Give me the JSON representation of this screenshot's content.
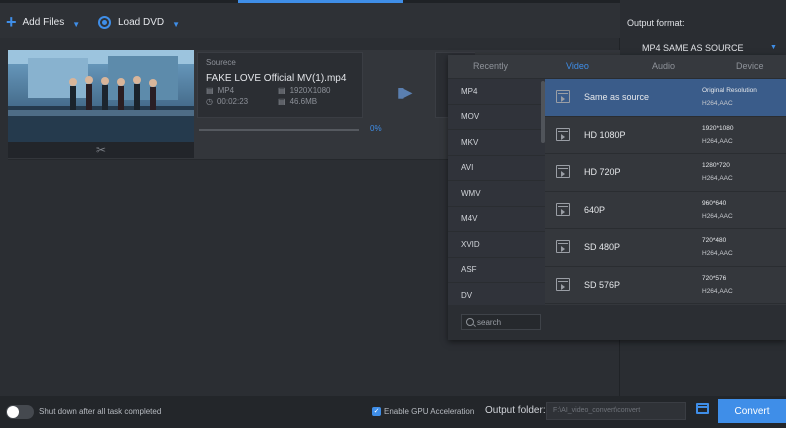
{
  "toolbar": {
    "add_files": "Add Files",
    "load_dvd": "Load DVD"
  },
  "task": {
    "source_label": "Sourece",
    "file_name": "FAKE LOVE Official MV(1).mp4",
    "format": "MP4",
    "resolution": "1920X1080",
    "duration": "00:02:23",
    "size": "46.6MB",
    "progress_text": "0%",
    "progress": 0
  },
  "output": {
    "label": "Output format:",
    "value": "MP4 SAME AS SOURCE"
  },
  "tabs": [
    "Recently",
    "Video",
    "Audio",
    "Device"
  ],
  "active_tab": "Video",
  "categories": [
    "MP4",
    "MOV",
    "MKV",
    "AVI",
    "WMV",
    "M4V",
    "XVID",
    "ASF",
    "DV"
  ],
  "formats": [
    {
      "name": "Same as source",
      "res": "Original Resolution",
      "codec": "H264,AAC"
    },
    {
      "name": "HD 1080P",
      "res": "1920*1080",
      "codec": "H264,AAC"
    },
    {
      "name": "HD 720P",
      "res": "1280*720",
      "codec": "H264,AAC"
    },
    {
      "name": "640P",
      "res": "960*640",
      "codec": "H264,AAC"
    },
    {
      "name": "SD 480P",
      "res": "720*480",
      "codec": "H264,AAC"
    },
    {
      "name": "SD 576P",
      "res": "720*576",
      "codec": "H264,AAC"
    }
  ],
  "search": {
    "placeholder": "search"
  },
  "bottom": {
    "shutdown_label": "Shut down after all task completed",
    "gpu_label": "Enable GPU Acceleration",
    "output_folder_label": "Output folder:",
    "folder_path": "F:\\AI_video_convert\\convert",
    "convert": "Convert"
  },
  "colors": {
    "accent": "#3f8ee8",
    "selected_row": "#3a5c8a"
  }
}
